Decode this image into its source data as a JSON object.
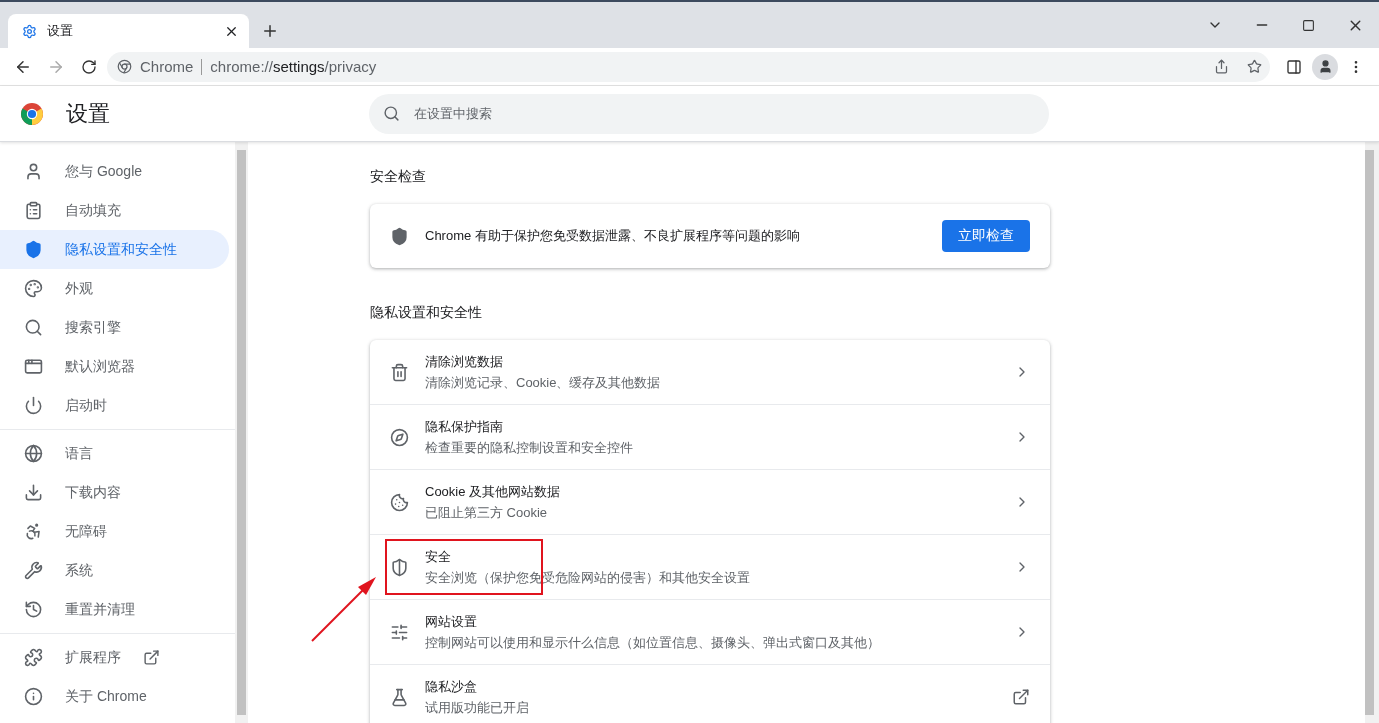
{
  "tab": {
    "title": "设置",
    "selected": true
  },
  "address": {
    "site": "Chrome",
    "url_prefix": "chrome://",
    "url_host": "settings",
    "url_path": "/privacy"
  },
  "header": {
    "title": "设置",
    "search_placeholder": "在设置中搜索"
  },
  "sidebar": {
    "groups": [
      {
        "items": [
          {
            "label": "您与 Google",
            "selected": false,
            "kind": "page"
          },
          {
            "label": "自动填充",
            "selected": false,
            "kind": "page"
          },
          {
            "label": "隐私设置和安全性",
            "selected": true,
            "kind": "page"
          },
          {
            "label": "外观",
            "selected": false,
            "kind": "page"
          },
          {
            "label": "搜索引擎",
            "selected": false,
            "kind": "page"
          },
          {
            "label": "默认浏览器",
            "selected": false,
            "kind": "page"
          },
          {
            "label": "启动时",
            "selected": false,
            "kind": "page"
          }
        ]
      },
      {
        "items": [
          {
            "label": "语言",
            "selected": false,
            "kind": "page"
          },
          {
            "label": "下载内容",
            "selected": false,
            "kind": "page"
          },
          {
            "label": "无障碍",
            "selected": false,
            "kind": "page"
          },
          {
            "label": "系统",
            "selected": false,
            "kind": "page"
          },
          {
            "label": "重置并清理",
            "selected": false,
            "kind": "page"
          }
        ]
      },
      {
        "items": [
          {
            "label": "扩展程序",
            "selected": false,
            "kind": "external"
          },
          {
            "label": "关于 Chrome",
            "selected": false,
            "kind": "page"
          }
        ]
      }
    ]
  },
  "safety_check": {
    "heading": "安全检查",
    "text": "Chrome 有助于保护您免受数据泄露、不良扩展程序等问题的影响",
    "button": "立即检查"
  },
  "privacy": {
    "heading": "隐私设置和安全性",
    "rows": [
      {
        "title": "清除浏览数据",
        "subtitle": "清除浏览记录、Cookie、缓存及其他数据",
        "kind": "arrow",
        "highlighted": false
      },
      {
        "title": "隐私保护指南",
        "subtitle": "检查重要的隐私控制设置和安全控件",
        "kind": "arrow",
        "highlighted": false
      },
      {
        "title": "Cookie 及其他网站数据",
        "subtitle": "已阻止第三方 Cookie",
        "kind": "arrow",
        "highlighted": false
      },
      {
        "title": "安全",
        "subtitle": "安全浏览（保护您免受危险网站的侵害）和其他安全设置",
        "kind": "arrow",
        "highlighted": true
      },
      {
        "title": "网站设置",
        "subtitle": "控制网站可以使用和显示什么信息（如位置信息、摄像头、弹出式窗口及其他）",
        "kind": "arrow",
        "highlighted": false
      },
      {
        "title": "隐私沙盒",
        "subtitle": "试用版功能已开启",
        "kind": "external",
        "highlighted": false
      }
    ]
  }
}
